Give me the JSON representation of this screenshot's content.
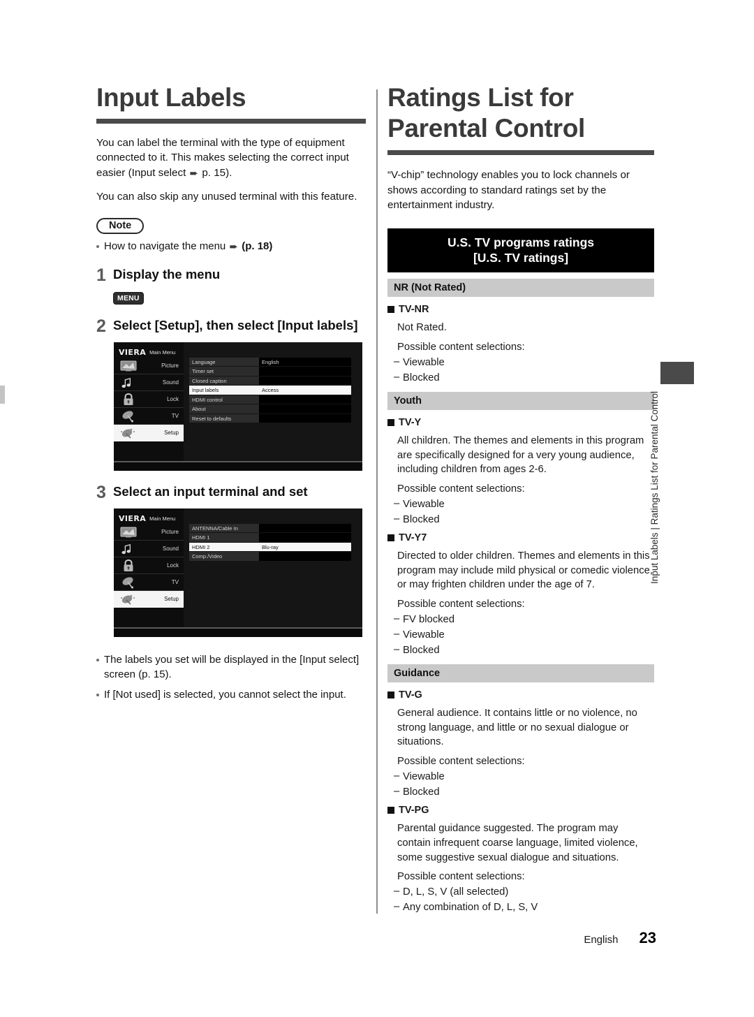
{
  "left": {
    "title": "Input Labels",
    "intro1": "You can label the terminal with the type of equipment connected to it. This makes selecting the correct input easier (Input select ",
    "intro1_ref": " p. 15).",
    "intro2": "You can also skip any unused terminal with this feature.",
    "note_badge": "Note",
    "note_item_text": "How to navigate the menu ",
    "note_item_ref": "(p. 18)",
    "steps": [
      {
        "num": "1",
        "text": "Display the menu"
      },
      {
        "num": "2",
        "text": "Select [Setup], then select [Input labels]"
      },
      {
        "num": "3",
        "text": "Select an input terminal and set"
      }
    ],
    "menu_key": "MENU",
    "notes_bottom": [
      "The labels you set will be displayed in the [Input select] screen (p. 15).",
      "If [Not used] is selected, you cannot select the input."
    ]
  },
  "tv_menu_1": {
    "brand": "VIERA",
    "brand_sub": "Main Menu",
    "sidebar": [
      {
        "label": "Picture",
        "icon": "tv-screen-icon",
        "selected": false
      },
      {
        "label": "Sound",
        "icon": "music-note-icon",
        "selected": false
      },
      {
        "label": "Lock",
        "icon": "padlock-icon",
        "selected": false
      },
      {
        "label": "TV",
        "icon": "antenna-icon",
        "selected": false
      },
      {
        "label": "Setup",
        "icon": "tools-icon",
        "selected": true
      }
    ],
    "rows": [
      {
        "label": "Language",
        "value": "English",
        "highlight": false
      },
      {
        "label": "Timer set",
        "value": "",
        "highlight": false
      },
      {
        "label": "Closed caption",
        "value": "",
        "highlight": false
      },
      {
        "label": "Input labels",
        "value": "Access",
        "highlight": true
      },
      {
        "label": "HDMI control",
        "value": "",
        "highlight": false
      },
      {
        "label": "About",
        "value": "",
        "highlight": false
      },
      {
        "label": "Reset to defaults",
        "value": "",
        "highlight": false
      }
    ]
  },
  "tv_menu_2": {
    "brand": "VIERA",
    "brand_sub": "Main Menu",
    "sidebar": [
      {
        "label": "Picture",
        "icon": "tv-screen-icon",
        "selected": false
      },
      {
        "label": "Sound",
        "icon": "music-note-icon",
        "selected": false
      },
      {
        "label": "Lock",
        "icon": "padlock-icon",
        "selected": false
      },
      {
        "label": "TV",
        "icon": "antenna-icon",
        "selected": false
      },
      {
        "label": "Setup",
        "icon": "tools-icon",
        "selected": true
      }
    ],
    "rows": [
      {
        "label": "ANTENNA/Cable In",
        "value": "",
        "highlight": false
      },
      {
        "label": "HDMI 1",
        "value": "",
        "highlight": false
      },
      {
        "label": "HDMI 2",
        "value": "Blu-ray",
        "highlight": true
      },
      {
        "label": "Comp./Video",
        "value": "",
        "highlight": false
      }
    ]
  },
  "right": {
    "title_line1": "Ratings List for",
    "title_line2": "Parental Control",
    "intro": "“V-chip” technology enables you to lock channels or shows according to standard ratings set by the entertainment industry.",
    "banner_line1": "U.S. TV programs ratings",
    "banner_line2": "[U.S. TV ratings]",
    "sections": [
      {
        "heading": "NR (Not Rated)",
        "ratings": [
          {
            "name": "TV-NR",
            "desc": "Not Rated.",
            "pcs_label": "Possible content selections:",
            "options": [
              "Viewable",
              "Blocked"
            ]
          }
        ]
      },
      {
        "heading": "Youth",
        "ratings": [
          {
            "name": "TV-Y",
            "desc": "All children. The themes and elements in this program are specifically designed for a very young audience, including children from ages 2-6.",
            "pcs_label": "Possible content selections:",
            "options": [
              "Viewable",
              "Blocked"
            ]
          },
          {
            "name": "TV-Y7",
            "desc": "Directed to older children. Themes and elements in this program may include mild physical or comedic violence, or may frighten children under the age of 7.",
            "pcs_label": "Possible content selections:",
            "options": [
              "FV blocked",
              "Viewable",
              "Blocked"
            ]
          }
        ]
      },
      {
        "heading": "Guidance",
        "ratings": [
          {
            "name": "TV-G",
            "desc": "General audience. It contains little or no violence, no strong language, and little or no sexual dialogue or situations.",
            "pcs_label": "Possible content selections:",
            "options": [
              "Viewable",
              "Blocked"
            ]
          },
          {
            "name": "TV-PG",
            "desc": "Parental guidance suggested. The program may contain infrequent coarse language, limited violence, some suggestive sexual dialogue and situations.",
            "pcs_label": "Possible content selections:",
            "options": [
              "D, L, S, V (all selected)",
              "Any combination of D, L, S, V"
            ]
          }
        ]
      }
    ]
  },
  "side_tab": {
    "text": "Input Labels  |  Ratings List for Parental Control"
  },
  "footer": {
    "language": "English",
    "page": "23"
  },
  "colors": {
    "banner_bg": "#000000",
    "section_head_bg": "#c9c9c9",
    "title_rule": "#4a4a4a",
    "title_text": "#3a3a3a",
    "step_num": "#5a5a5a"
  }
}
